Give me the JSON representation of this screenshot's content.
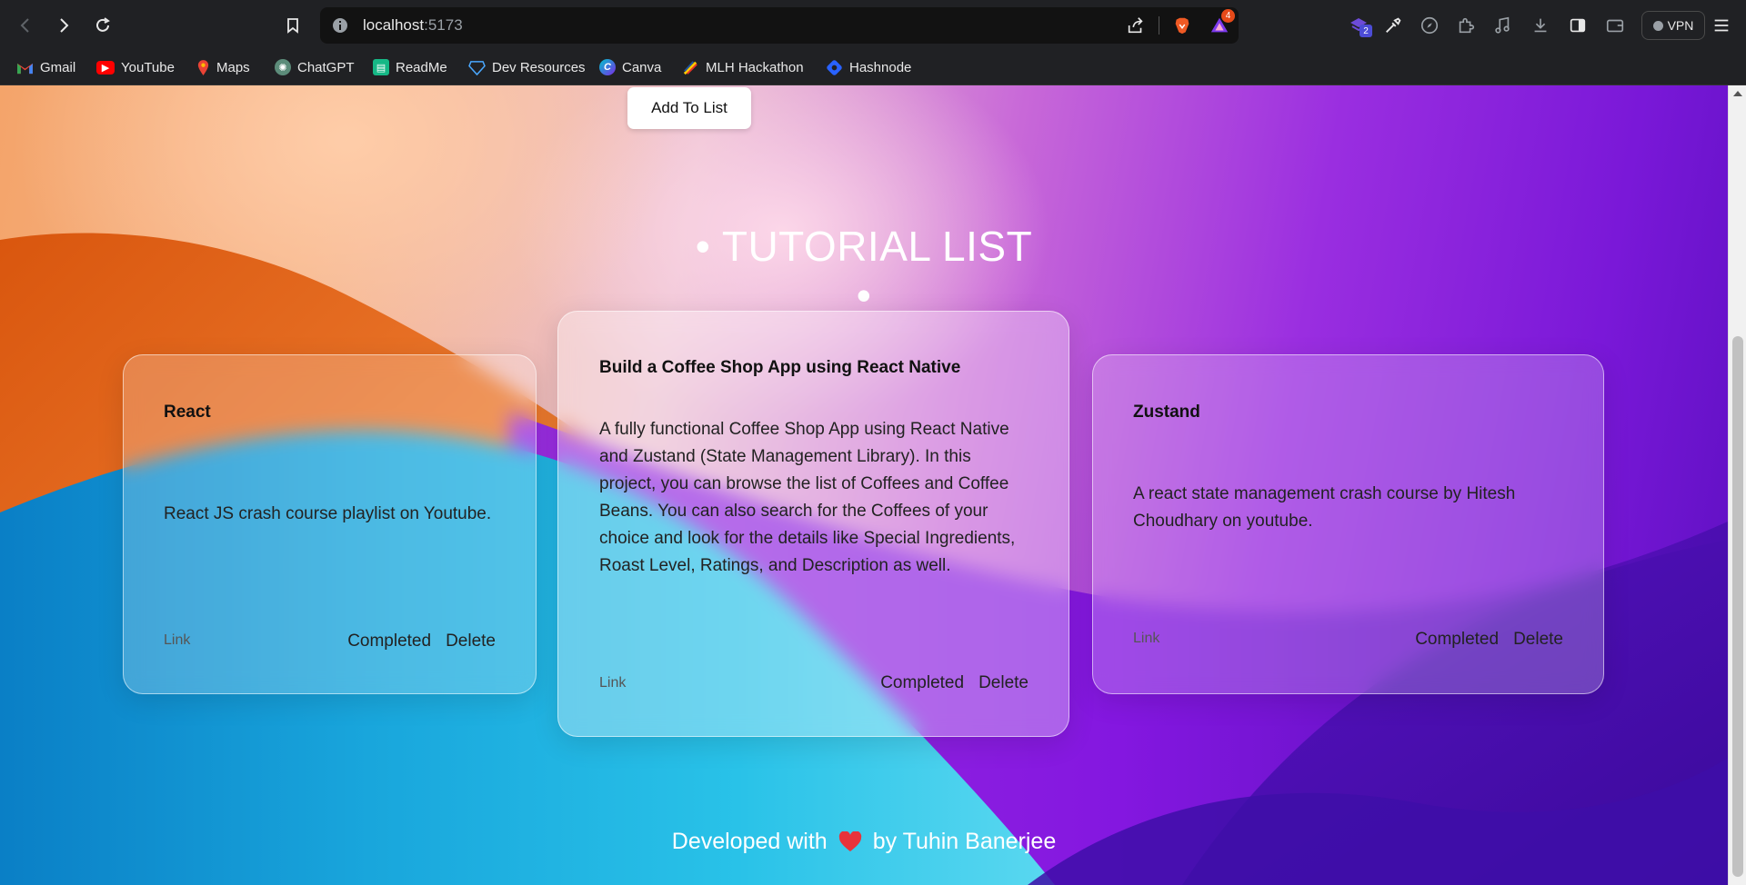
{
  "browser": {
    "url_host": "localhost",
    "url_port": ":5173",
    "brave_badge": "4",
    "ext_badge": "2",
    "vpn_label": "VPN"
  },
  "bookmarks": [
    {
      "label": "Gmail",
      "icon": "gmail-icon"
    },
    {
      "label": "YouTube",
      "icon": "youtube-icon"
    },
    {
      "label": "Maps",
      "icon": "maps-icon"
    },
    {
      "label": "ChatGPT",
      "icon": "chatgpt-icon"
    },
    {
      "label": "ReadMe",
      "icon": "readme-icon"
    },
    {
      "label": "Dev Resources",
      "icon": "dev-resources-icon"
    },
    {
      "label": "Canva",
      "icon": "canva-icon"
    },
    {
      "label": "MLH Hackathon",
      "icon": "mlh-icon"
    },
    {
      "label": "Hashnode",
      "icon": "hashnode-icon"
    }
  ],
  "page": {
    "add_button": "Add To List",
    "list_title": "• TUTORIAL LIST •",
    "footer_prefix": "Developed with",
    "footer_suffix": "by Tuhin Banerjee"
  },
  "cards": [
    {
      "title": "React",
      "description": "React JS crash course playlist on Youtube.",
      "link": "Link",
      "completed": "Completed",
      "delete": "Delete"
    },
    {
      "title": "Build a Coffee Shop App using React Native",
      "description": "A fully functional Coffee Shop App using React Native and Zustand (State Management Library). In this project, you can browse the list of Coffees and Coffee Beans. You can also search for the Coffees of your choice and look for the details like Special Ingredients, Roast Level, Ratings, and Description as well.",
      "link": "Link",
      "completed": "Completed",
      "delete": "Delete"
    },
    {
      "title": "Zustand",
      "description": "A react state management crash course by Hitesh Choudhary on youtube.",
      "link": "Link",
      "completed": "Completed",
      "delete": "Delete"
    }
  ],
  "colors": {
    "chrome_bg": "#202124",
    "urlbar_bg": "#121212",
    "heart": "#e8323a"
  }
}
